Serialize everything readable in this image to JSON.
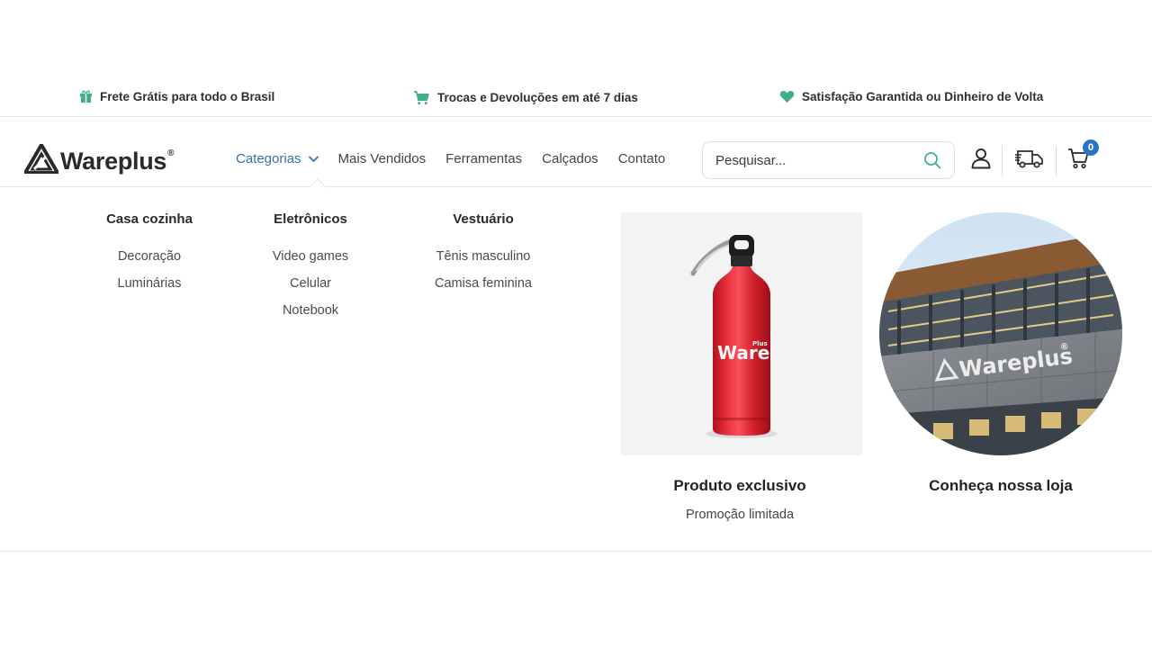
{
  "topbar": {
    "items": [
      {
        "icon": "gift-icon",
        "text": "Frete Grátis para todo o Brasil"
      },
      {
        "icon": "cart-icon",
        "text": "Trocas e Devoluções em até 7 dias"
      },
      {
        "icon": "heart-icon",
        "text": "Satisfação Garantida ou Dinheiro de Volta"
      }
    ],
    "icon_color": "#3fae8c"
  },
  "header": {
    "logo_text": "Wareplus",
    "logo_reg": "®",
    "nav": [
      {
        "label": "Categorias",
        "active": true
      },
      {
        "label": "Mais Vendidos"
      },
      {
        "label": "Ferramentas"
      },
      {
        "label": "Calçados"
      },
      {
        "label": "Contato"
      }
    ],
    "search_placeholder": "Pesquisar...",
    "cart_count": "0",
    "icons": [
      "user-icon",
      "truck-icon",
      "cart-icon",
      "search-icon"
    ],
    "accent_color": "#3a6fb0",
    "badge_color": "#2d74c9"
  },
  "mega_menu": {
    "columns": [
      {
        "title": "Casa cozinha",
        "links": [
          "Decoração",
          "Luminárias"
        ]
      },
      {
        "title": "Eletrônicos",
        "links": [
          "Video games",
          "Celular",
          "Notebook"
        ]
      },
      {
        "title": "Vestuário",
        "links": [
          "Tênis masculino",
          "Camisa feminina"
        ]
      }
    ],
    "promo": {
      "title": "Produto exclusivo",
      "subtitle": "Promoção limitada",
      "bottle_brand": "Ware",
      "bottle_sub": "Plus"
    },
    "store": {
      "title": "Conheça nossa loja",
      "sign_text": "Wareplus",
      "sign_reg": "®"
    }
  }
}
